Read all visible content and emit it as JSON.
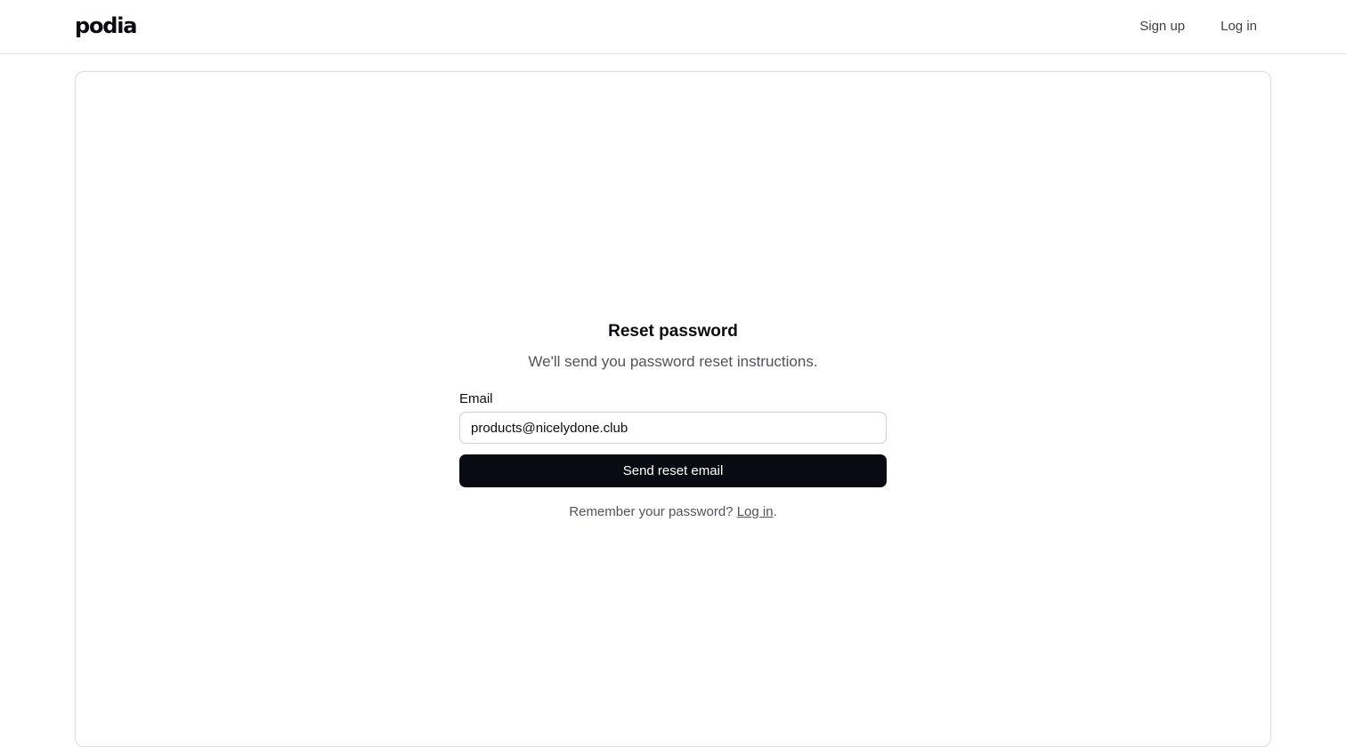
{
  "header": {
    "logo_text": "podia",
    "nav": {
      "signup_label": "Sign up",
      "login_label": "Log in"
    }
  },
  "reset_form": {
    "title": "Reset password",
    "subtitle": "We'll send you password reset instructions.",
    "email_label": "Email",
    "email_value": "products@nicelydone.club",
    "submit_label": "Send reset email",
    "remember_text": "Remember your password? ",
    "remember_link": "Log in",
    "remember_suffix": "."
  }
}
